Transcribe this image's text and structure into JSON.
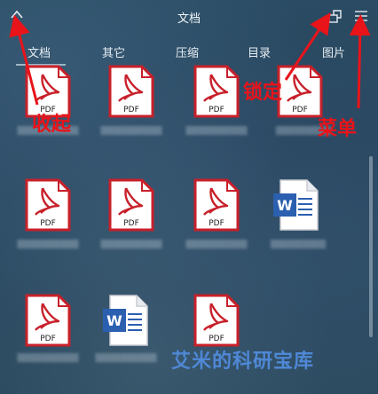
{
  "header": {
    "title": "文档"
  },
  "tabs": [
    {
      "label": "文档",
      "active": true
    },
    {
      "label": "其它",
      "active": false
    },
    {
      "label": "压缩",
      "active": false
    },
    {
      "label": "目录",
      "active": false
    },
    {
      "label": "图片",
      "active": false
    }
  ],
  "files": [
    {
      "type": "pdf",
      "icon": "pdf-icon",
      "label": "PDF"
    },
    {
      "type": "pdf",
      "icon": "pdf-icon",
      "label": "PDF"
    },
    {
      "type": "pdf",
      "icon": "pdf-icon",
      "label": "PDF"
    },
    {
      "type": "pdf",
      "icon": "pdf-icon",
      "label": "PDF"
    },
    {
      "type": "pdf",
      "icon": "pdf-icon",
      "label": "PDF"
    },
    {
      "type": "pdf",
      "icon": "pdf-icon",
      "label": "PDF"
    },
    {
      "type": "pdf",
      "icon": "pdf-icon",
      "label": "PDF"
    },
    {
      "type": "word",
      "icon": "word-icon",
      "label": "W"
    },
    {
      "type": "pdf",
      "icon": "pdf-icon",
      "label": "PDF"
    },
    {
      "type": "word",
      "icon": "word-icon",
      "label": "W"
    },
    {
      "type": "pdf",
      "icon": "pdf-icon",
      "label": "PDF"
    }
  ],
  "annotations": {
    "collapse": "收起",
    "lock": "锁定",
    "menu": "菜单"
  },
  "watermark": "艾米的科研宝库",
  "colors": {
    "pdf_red": "#c8202a",
    "word_blue": "#2b5fb0",
    "annotation_red": "#e8141a",
    "watermark_blue": "#4f88d6"
  }
}
